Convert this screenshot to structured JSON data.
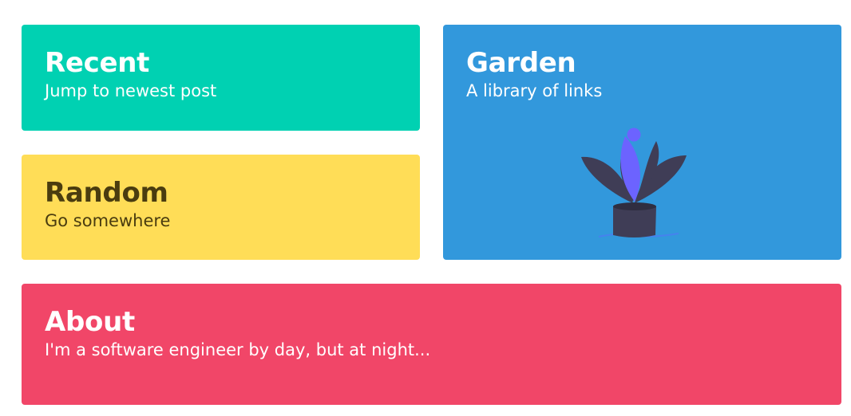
{
  "cards": {
    "recent": {
      "title": "Recent",
      "subtitle": "Jump to newest post",
      "color": "#00d1b2"
    },
    "random": {
      "title": "Random",
      "subtitle": "Go somewhere",
      "color": "#ffdd57"
    },
    "garden": {
      "title": "Garden",
      "subtitle": "A library of links",
      "color": "#3298dc",
      "illustration": "potted-plant-illustration"
    },
    "about": {
      "title": "About",
      "subtitle": "I'm a software engineer by day, but at night...",
      "color": "#f14668"
    }
  }
}
